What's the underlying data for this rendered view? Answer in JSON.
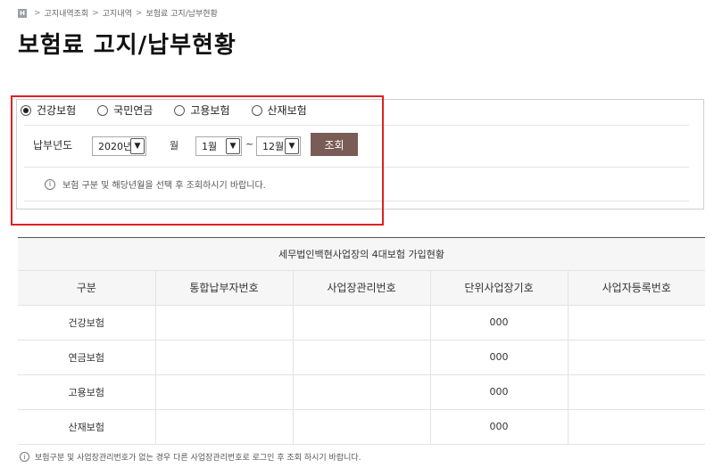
{
  "breadcrumb": {
    "home_icon_label": "H",
    "items": [
      "고지내역조회",
      "고지내역",
      "보험료 고지/납부현황"
    ]
  },
  "page_title": "보험료 고지/납부현황",
  "insurance_types": [
    {
      "label": "건강보험",
      "checked": true
    },
    {
      "label": "국민연금",
      "checked": false
    },
    {
      "label": "고용보험",
      "checked": false
    },
    {
      "label": "산재보험",
      "checked": false
    }
  ],
  "filter": {
    "year_label": "납부년도",
    "year_value": "2020년",
    "month_label": "월",
    "month_from": "1월",
    "tilde": "~",
    "month_to": "12월",
    "search_label": "조회",
    "info_icon_label": "i",
    "info_note": "보험 구분 및 해당년월을 선택 후 조회하시기 바랍니다."
  },
  "table": {
    "title": "세무법인백현사업장의 4대보험 가입현황",
    "headers": [
      "구분",
      "통합납부자번호",
      "사업장관리번호",
      "단위사업장기호",
      "사업자등록번호"
    ],
    "rows": [
      [
        "건강보험",
        "",
        "",
        "000",
        ""
      ],
      [
        "연금보험",
        "",
        "",
        "000",
        ""
      ],
      [
        "고용보험",
        "",
        "",
        "000",
        ""
      ],
      [
        "산재보험",
        "",
        "",
        "000",
        ""
      ]
    ]
  },
  "bottom_note": {
    "icon_label": "i",
    "text": "보험구분 및 사업장관리번호가 없는 경우 다른 사업장관리번호로 로그인 후 조회 하시기 바랍니다."
  },
  "colors": {
    "search_button": "#7a5c57",
    "highlight_border": "#e02020"
  },
  "icons": {
    "home": "home-icon",
    "info": "info-icon",
    "dropdown": "chevron-down-icon"
  }
}
